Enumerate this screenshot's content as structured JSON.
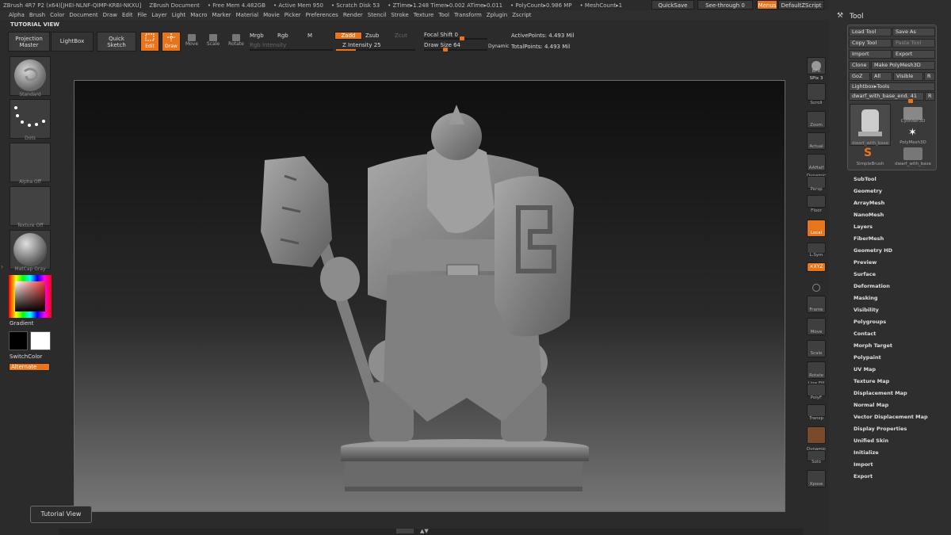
{
  "titlebar": {
    "app": "ZBrush 4R7 P2 (x64)[JHEI-NLNF-QIMP-KRBI-NKXU]",
    "document": "ZBrush Document",
    "free_mem": "• Free Mem 4.482GB",
    "active_mem": "• Active Mem 950",
    "scratch": "• Scratch Disk 53",
    "ztime": "• ZTime▸1.248 Timer▸0.002 ATime▸0.011",
    "polycount": "• PolyCount▸0.986 MP",
    "meshcount": "• MeshCount▸1",
    "quicksave": "QuickSave",
    "see_through": "See-through  0",
    "menus": "Menus",
    "script": "DefaultZScript"
  },
  "menubar": [
    "Alpha",
    "Brush",
    "Color",
    "Document",
    "Draw",
    "Edit",
    "File",
    "Layer",
    "Light",
    "Macro",
    "Marker",
    "Material",
    "Movie",
    "Picker",
    "Preferences",
    "Render",
    "Stencil",
    "Stroke",
    "Texture",
    "Tool",
    "Transform",
    "Zplugin",
    "Zscript"
  ],
  "toolbar": {
    "tutorial_view": "TUTORIAL VIEW",
    "projection_master": "Projection\nMaster",
    "lightbox": "LightBox",
    "quick_sketch": "Quick\nSketch",
    "edit": "Edit",
    "draw": "Draw",
    "move": "Move",
    "scale": "Scale",
    "rotate": "Rotate",
    "mrgb": "Mrgb",
    "rgb": "Rgb",
    "m": "M",
    "zadd": "Zadd",
    "zsub": "Zsub",
    "zcut": "Zcut",
    "rgb_intensity": "Rgb Intensity",
    "z_intensity": "Z Intensity 25",
    "z_intensity_value": 25,
    "focal_shift": "Focal Shift 0",
    "draw_size": "Draw Size 64",
    "draw_size_value": 64,
    "dynamic": "Dynamic",
    "active_points": "ActivePoints: 4.493 Mil",
    "total_points": "TotalPoints: 4.493 Mil"
  },
  "leftshelf": {
    "standard": "Standard",
    "dots": "Dots",
    "alpha_off": "Alpha Off",
    "texture_off": "Texture Off",
    "matcap": "MatCap Gray",
    "gradient": "Gradient",
    "switchcolor": "SwitchColor",
    "alternate": "Alternate"
  },
  "rightshelf": {
    "bpr": "BPR",
    "spix": "SPix 3",
    "scroll": "Scroll",
    "zoom": "Zoom",
    "actual": "Actual",
    "aahalf": "AAHalf",
    "dynamic": "Dynamic",
    "persp": "Persp",
    "floor": "Floor",
    "local": "Local",
    "lsym": "L.Sym",
    "xyz": "✕XYZ",
    "frame": "Frame",
    "move": "Move",
    "scale": "Scale",
    "rotate": "Rotate",
    "line_fill": "Line Fill",
    "polyf": "PolyF",
    "transp": "Transp",
    "dynamic2": "Dynamic",
    "solo": "Solo",
    "xpose": "Xpose"
  },
  "tool_panel": {
    "title": "Tool",
    "load_tool": "Load Tool",
    "save_as": "Save As",
    "copy_tool": "Copy Tool",
    "paste_tool": "Paste Tool",
    "import": "Import",
    "export": "Export",
    "clone": "Clone",
    "make_polymesh": "Make PolyMesh3D",
    "goz": "GoZ",
    "all": "All",
    "visible": "Visible",
    "r": "R",
    "lightbox_tools": "Lightbox▸Tools",
    "current_tool": "dwarf_with_base_end. 41",
    "r2": "R",
    "thumb_dwarf": "dwarf_with_base",
    "thumb_cylinder": "Cylinder3D",
    "thumb_polymesh": "PolyMesh3D",
    "thumb_simplebrush": "SimpleBrush",
    "thumb_dwarf2": "dwarf_with_base",
    "menu": [
      "SubTool",
      "Geometry",
      "ArrayMesh",
      "NanoMesh",
      "Layers",
      "FiberMesh",
      "Geometry HD",
      "Preview",
      "Surface",
      "Deformation",
      "Masking",
      "Visibility",
      "Polygroups",
      "Contact",
      "Morph Target",
      "Polypaint",
      "UV Map",
      "Texture Map",
      "Displacement Map",
      "Normal Map",
      "Vector Displacement Map",
      "Display Properties",
      "Unified Skin",
      "Initialize",
      "Import",
      "Export"
    ]
  },
  "tutorial_tip": "Tutorial View",
  "colors": {
    "accent": "#e8741b",
    "panel": "#2b2b2b",
    "button": "#3c3c3c"
  }
}
